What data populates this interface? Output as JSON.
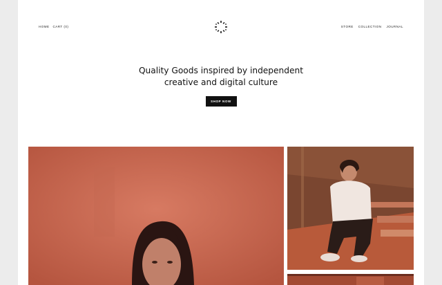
{
  "nav": {
    "left": [
      {
        "label": "HOME"
      },
      {
        "label": "CART (0)"
      }
    ],
    "right": [
      {
        "label": "STORE"
      },
      {
        "label": "COLLECTION"
      },
      {
        "label": "JOURNAL"
      }
    ]
  },
  "hero": {
    "line1": "Quality Goods inspired by independent",
    "line2": "creative and digital culture",
    "button_label": "SHOP NOW"
  },
  "colors": {
    "page_bg": "#ffffff",
    "outer_bg": "#ececec",
    "button_bg": "#111111"
  },
  "icons": {
    "logo": "circular-dot-logo"
  }
}
